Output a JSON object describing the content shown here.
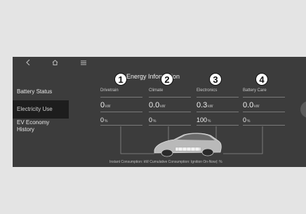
{
  "sidebar": {
    "items": [
      {
        "label": "Battery Status"
      },
      {
        "label": "Electricity Use",
        "active": true
      },
      {
        "label": "EV Economy History"
      }
    ]
  },
  "main": {
    "title": "Energy Information",
    "columns": [
      {
        "label": "Drivetrain",
        "value": "0",
        "unit": "kW",
        "percent": "0",
        "percent_unit": "%",
        "badge": "1"
      },
      {
        "label": "Climate",
        "value": "0.0",
        "unit": "kW",
        "percent": "0",
        "percent_unit": "%",
        "badge": "2"
      },
      {
        "label": "Electronics",
        "value": "0.3",
        "unit": "kW",
        "percent": "100",
        "percent_unit": "%",
        "badge": "3"
      },
      {
        "label": "Battery Care",
        "value": "0.0",
        "unit": "kW",
        "percent": "0",
        "percent_unit": "%",
        "badge": "4"
      }
    ],
    "caption": "Instant Consumption: kW   Cumulative Consumption: Ignition On-Now(: %"
  },
  "icons": {
    "back": "back-icon",
    "home": "home-icon",
    "menu": "menu-icon"
  }
}
